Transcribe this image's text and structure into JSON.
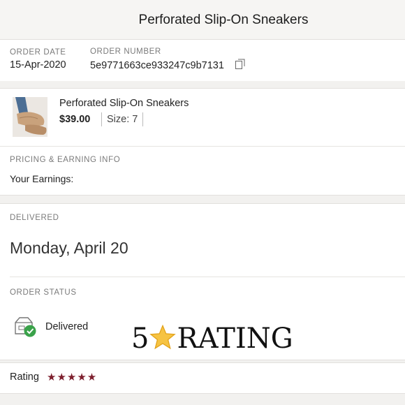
{
  "header": {
    "title": "Perforated Slip-On Sneakers"
  },
  "order": {
    "date_label": "ORDER DATE",
    "date": "15-Apr-2020",
    "number_label": "ORDER NUMBER",
    "number": "5e9771663ce933247c9b7131"
  },
  "item": {
    "name": "Perforated Slip-On Sneakers",
    "price": "$39.00",
    "size": "Size: 7"
  },
  "pricing": {
    "section_label": "PRICING & EARNING INFO",
    "earnings_label": "Your Earnings:"
  },
  "delivery": {
    "section_label": "DELIVERED",
    "date": "Monday, April 20",
    "status_label": "ORDER STATUS",
    "status": "Delivered"
  },
  "overlay": {
    "number": "5",
    "text": "RATING"
  },
  "rating": {
    "label": "Rating",
    "stars": "★★★★★",
    "value": 5,
    "max": 5,
    "color": "#7d1f2d"
  },
  "icons": {
    "copy": "copy-icon",
    "status": "package-check-icon",
    "star": "star-icon"
  }
}
